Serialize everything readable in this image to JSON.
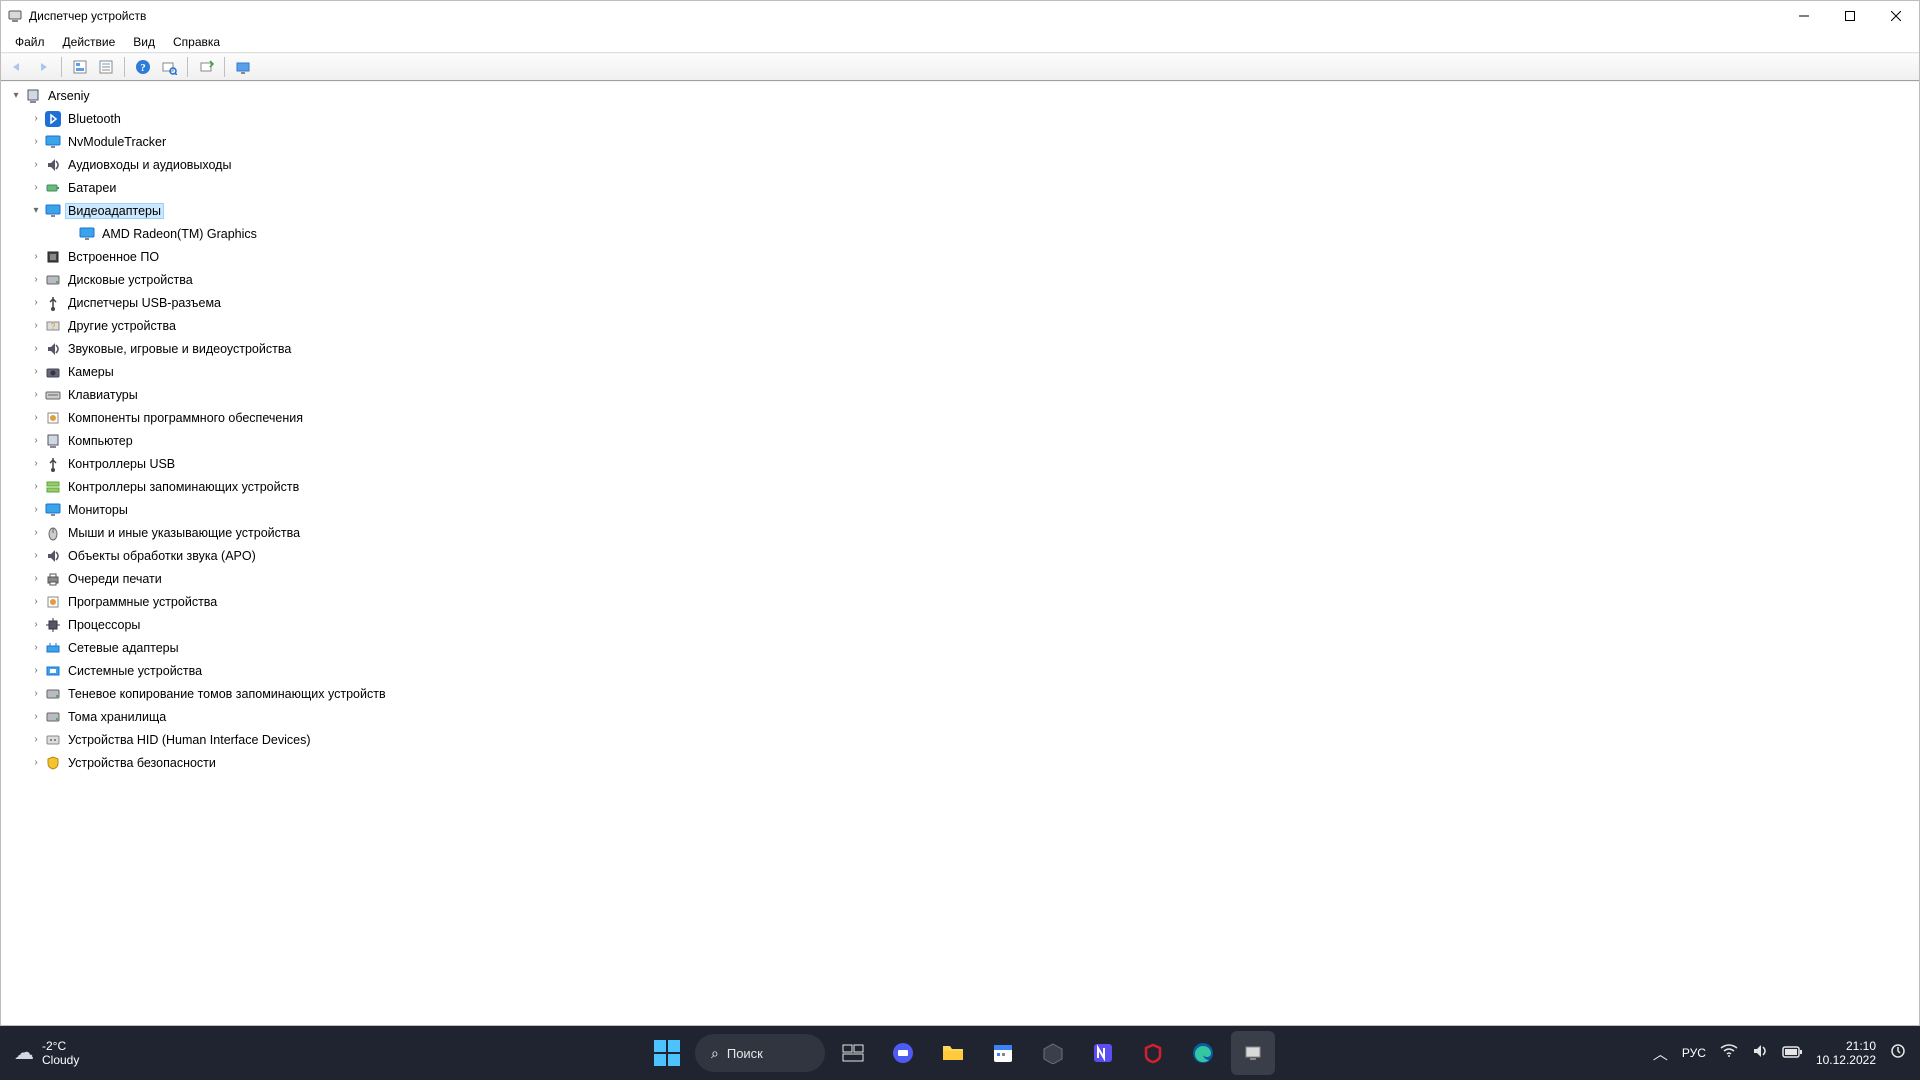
{
  "window": {
    "title": "Диспетчер устройств"
  },
  "menu": {
    "file": "Файл",
    "action": "Действие",
    "view": "Вид",
    "help": "Справка"
  },
  "tree": {
    "root": "Arseniy",
    "nodes": [
      {
        "label": "Bluetooth",
        "icon": "bluetooth",
        "expanded": false
      },
      {
        "label": "NvModuleTracker",
        "icon": "monitor",
        "expanded": false
      },
      {
        "label": "Аудиовходы и аудиовыходы",
        "icon": "audio",
        "expanded": false
      },
      {
        "label": "Батареи",
        "icon": "battery",
        "expanded": false
      },
      {
        "label": "Видеоадаптеры",
        "icon": "monitor",
        "expanded": true,
        "selected": true,
        "children": [
          {
            "label": "AMD Radeon(TM) Graphics",
            "icon": "monitor"
          }
        ]
      },
      {
        "label": "Встроенное ПО",
        "icon": "chip",
        "expanded": false
      },
      {
        "label": "Дисковые устройства",
        "icon": "disk",
        "expanded": false
      },
      {
        "label": "Диспетчеры USB-разъема",
        "icon": "usb",
        "expanded": false
      },
      {
        "label": "Другие устройства",
        "icon": "other",
        "expanded": false
      },
      {
        "label": "Звуковые, игровые и видеоустройства",
        "icon": "audio",
        "expanded": false
      },
      {
        "label": "Камеры",
        "icon": "camera",
        "expanded": false
      },
      {
        "label": "Клавиатуры",
        "icon": "keyboard",
        "expanded": false
      },
      {
        "label": "Компоненты программного обеспечения",
        "icon": "sw",
        "expanded": false
      },
      {
        "label": "Компьютер",
        "icon": "pc",
        "expanded": false
      },
      {
        "label": "Контроллеры USB",
        "icon": "usb",
        "expanded": false
      },
      {
        "label": "Контроллеры запоминающих устройств",
        "icon": "storage",
        "expanded": false
      },
      {
        "label": "Мониторы",
        "icon": "monitor",
        "expanded": false
      },
      {
        "label": "Мыши и иные указывающие устройства",
        "icon": "mouse",
        "expanded": false
      },
      {
        "label": "Объекты обработки звука (APO)",
        "icon": "audio",
        "expanded": false
      },
      {
        "label": "Очереди печати",
        "icon": "printer",
        "expanded": false
      },
      {
        "label": "Программные устройства",
        "icon": "sw",
        "expanded": false
      },
      {
        "label": "Процессоры",
        "icon": "cpu",
        "expanded": false
      },
      {
        "label": "Сетевые адаптеры",
        "icon": "net",
        "expanded": false
      },
      {
        "label": "Системные устройства",
        "icon": "system",
        "expanded": false
      },
      {
        "label": "Теневое копирование томов запоминающих устройств",
        "icon": "disk",
        "expanded": false
      },
      {
        "label": "Тома хранилища",
        "icon": "disk",
        "expanded": false
      },
      {
        "label": "Устройства HID (Human Interface Devices)",
        "icon": "hid",
        "expanded": false
      },
      {
        "label": "Устройства безопасности",
        "icon": "security",
        "expanded": false
      }
    ]
  },
  "toolbar": {
    "back": "Назад",
    "forward": "Вперёд",
    "show_hidden": "Показать скрытые",
    "properties": "Свойства",
    "help": "Справка",
    "update": "Обновить конфигурацию",
    "scan": "Обновить конфигурацию оборудования",
    "add": "Добавить устройство"
  },
  "taskbar": {
    "weather": {
      "temp": "-2°C",
      "cond": "Cloudy"
    },
    "search": "Поиск",
    "lang": "РУС",
    "time": "21:10",
    "date": "10.12.2022"
  }
}
